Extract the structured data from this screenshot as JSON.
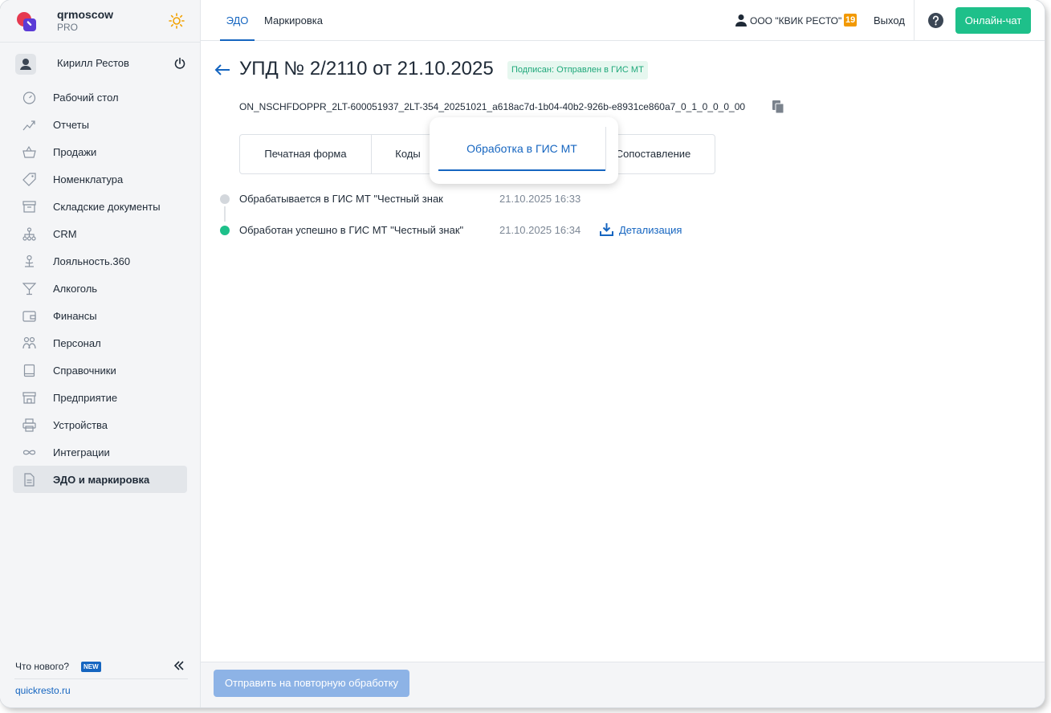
{
  "brand": {
    "name": "qrmoscow",
    "plan": "PRO"
  },
  "user": {
    "name": "Кирилл Рестов"
  },
  "sidebar": {
    "items": [
      {
        "label": "Рабочий стол",
        "icon": "dashboard-icon"
      },
      {
        "label": "Отчеты",
        "icon": "chart-icon"
      },
      {
        "label": "Продажи",
        "icon": "basket-icon"
      },
      {
        "label": "Номенклатура",
        "icon": "tag-icon"
      },
      {
        "label": "Складские документы",
        "icon": "archive-icon"
      },
      {
        "label": "CRM",
        "icon": "org-chart-icon"
      },
      {
        "label": "Лояльность.360",
        "icon": "loyalty-icon"
      },
      {
        "label": "Алкоголь",
        "icon": "cocktail-icon"
      },
      {
        "label": "Финансы",
        "icon": "wallet-icon"
      },
      {
        "label": "Персонал",
        "icon": "people-icon"
      },
      {
        "label": "Справочники",
        "icon": "book-icon"
      },
      {
        "label": "Предприятие",
        "icon": "store-icon"
      },
      {
        "label": "Устройства",
        "icon": "printer-icon"
      },
      {
        "label": "Интеграции",
        "icon": "infinity-icon"
      },
      {
        "label": "ЭДО и маркировка",
        "icon": "document-icon",
        "active": true
      }
    ],
    "whats_new": "Что нового?",
    "new_badge": "NEW",
    "site_link": "quickresto.ru"
  },
  "topbar": {
    "tabs": [
      {
        "label": "ЭДО",
        "active": true
      },
      {
        "label": "Маркировка",
        "active": false
      }
    ],
    "org_name": "ООО \"КВИК РЕСТО\"",
    "org_badge": "19",
    "logout": "Выход",
    "chat_button": "Онлайн-чат"
  },
  "document": {
    "title": "УПД № 2/2110 от 21.10.2025",
    "status": "Подписан: Отправлен в ГИС МТ",
    "file_name": "ON_NSCHFDOPPR_2LT-600051937_2LT-354_20251021_a618ac7d-1b04-40b2-926b-e8931ce860a7_0_1_0_0_0_00"
  },
  "tabs": [
    {
      "label": "Печатная форма",
      "active": false
    },
    {
      "label": "Коды",
      "active": false
    },
    {
      "label": "Обработка в ГИС МТ",
      "active": true
    },
    {
      "label": "Сопоставление",
      "active": false
    }
  ],
  "timeline": [
    {
      "text": "Обрабатывается в ГИС МТ \"Честный знак",
      "time": "21.10.2025 16:33",
      "status": "pending"
    },
    {
      "text": "Обработан успешно в ГИС МТ \"Честный знак\"",
      "time": "21.10.2025 16:34",
      "status": "success",
      "link": "Детализация"
    }
  ],
  "footer": {
    "resend_button": "Отправить на повторную обработку"
  },
  "colors": {
    "accent": "#1565c0",
    "success": "#1ec08a",
    "pending_dot": "#d3d7dc",
    "badge_orange": "#f29900"
  }
}
